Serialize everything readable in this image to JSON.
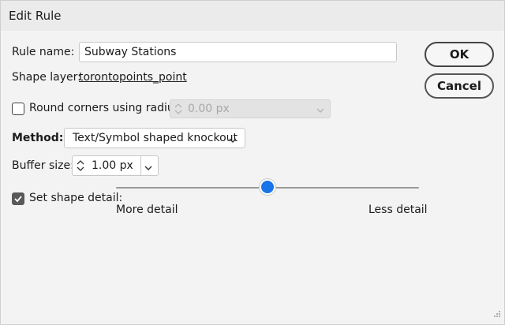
{
  "window": {
    "title": "Edit Rule"
  },
  "rule_name": {
    "label": "Rule name:",
    "value": "Subway Stations"
  },
  "shape_layer": {
    "label": "Shape layer:",
    "value": "torontopoints_point"
  },
  "buttons": {
    "ok": "OK",
    "cancel": "Cancel"
  },
  "round_corners": {
    "label": "Round corners using radius:",
    "checked": false,
    "value": "0.00 px",
    "enabled": false
  },
  "method": {
    "label": "Method:",
    "value": "Text/Symbol shaped knockout"
  },
  "buffer_size": {
    "label": "Buffer size:",
    "value": "1.00 px"
  },
  "shape_detail": {
    "label": "Set shape detail:",
    "checked": true,
    "min_label": "More detail",
    "max_label": "Less detail",
    "level_fraction": 0.5
  },
  "colors": {
    "accent": "#1a73e8",
    "title_bar": "#ecebec",
    "background": "#f3f3f3"
  }
}
